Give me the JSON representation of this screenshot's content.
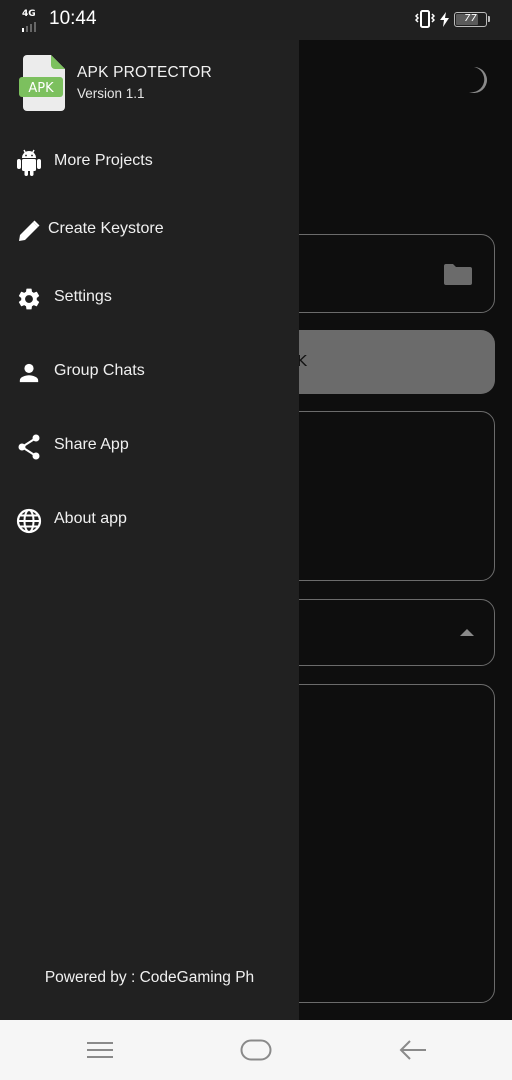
{
  "status_bar": {
    "network": "4G",
    "time": "10:44",
    "battery_level": "77",
    "battery_fraction": 0.77,
    "icons": [
      "signal-icon",
      "vibrate-icon",
      "charging-icon",
      "battery-icon"
    ]
  },
  "drawer": {
    "app_title": "APK PROTECTOR",
    "app_version": "Version 1.1",
    "app_icon_label": "APK",
    "items": [
      {
        "label": "More Projects",
        "icon": "android-icon"
      },
      {
        "label": "Create Keystore",
        "icon": "pencil-icon"
      },
      {
        "label": "Settings",
        "icon": "gear-icon"
      },
      {
        "label": "Group Chats",
        "icon": "person-icon"
      },
      {
        "label": "Share App",
        "icon": "share-icon"
      },
      {
        "label": "About app",
        "icon": "globe-icon"
      }
    ],
    "footer": "Powered by : CodeGaming Ph"
  },
  "main": {
    "theme_toggle_icon": "moon-icon",
    "file_field_icon": "folder-icon",
    "primary_button_partial_label": "K",
    "dropdown_icon": "caret-up-icon"
  },
  "nav_bar": {
    "buttons": [
      "menu-icon",
      "home-icon",
      "back-icon"
    ]
  },
  "colors": {
    "drawer_bg": "#212121",
    "main_bg": "#0e0e0e",
    "apk_green": "#7cc05e",
    "border_gray": "#6b6b6b"
  }
}
